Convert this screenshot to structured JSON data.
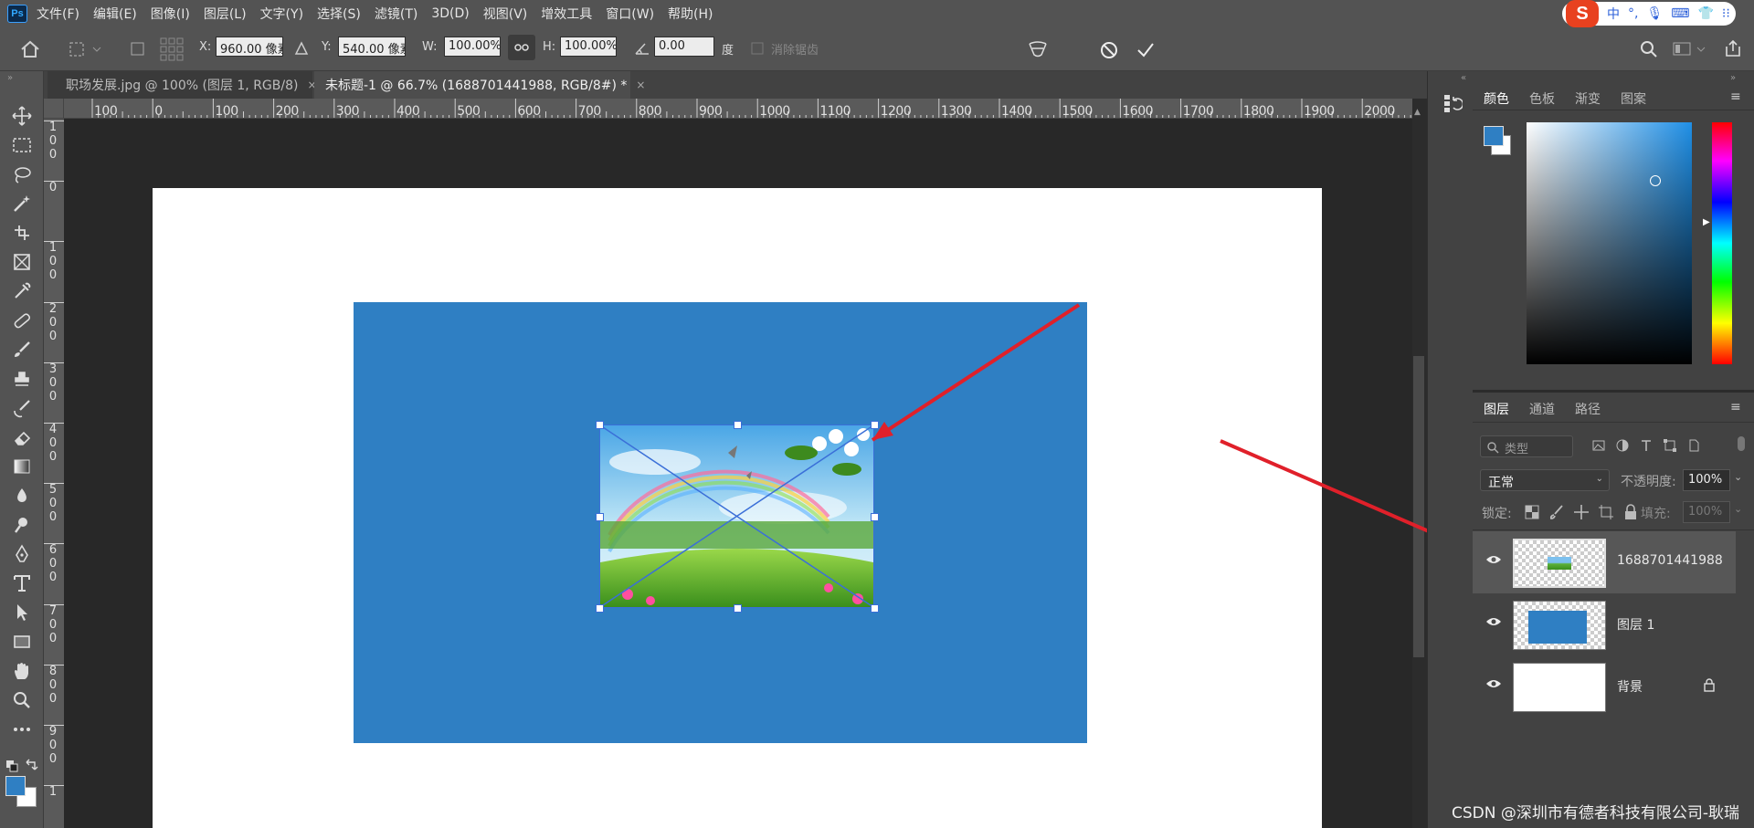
{
  "app": {
    "logo": "Ps"
  },
  "menu": [
    "文件(F)",
    "编辑(E)",
    "图像(I)",
    "图层(L)",
    "文字(Y)",
    "选择(S)",
    "滤镜(T)",
    "3D(D)",
    "视图(V)",
    "增效工具",
    "窗口(W)",
    "帮助(H)"
  ],
  "ime": {
    "logo": "S",
    "items": [
      "中",
      "°,",
      "🎙",
      "⌨",
      "👕",
      "⁝⁝"
    ]
  },
  "options": {
    "x_label": "X:",
    "x_value": "960.00 像素",
    "y_label": "Y:",
    "y_value": "540.00 像素",
    "w_label": "W:",
    "w_value": "100.00%",
    "h_label": "H:",
    "h_value": "100.00%",
    "angle_value": "0.00",
    "angle_unit": "度",
    "antialias_label": "消除锯齿"
  },
  "tabs": [
    {
      "label": "职场发展.jpg @ 100% (图层 1, RGB/8)",
      "close": "×"
    },
    {
      "label": "未标题-1 @ 66.7% (1688701441988, RGB/8#) *",
      "close": "×"
    }
  ],
  "ruler": {
    "h": [
      "100",
      "0",
      "100",
      "200",
      "300",
      "400",
      "500",
      "600",
      "700",
      "800",
      "900",
      "1000",
      "1100",
      "1200",
      "1300",
      "1400",
      "1500",
      "1600",
      "1700",
      "1800",
      "1900",
      "2000"
    ],
    "v": [
      "100",
      "0",
      "100",
      "200",
      "300",
      "400",
      "500",
      "600",
      "700",
      "800",
      "900",
      "1"
    ]
  },
  "color_panel": {
    "tabs": [
      "颜色",
      "色板",
      "渐变",
      "图案"
    ],
    "foreground": "#2f7fc3",
    "background": "#ffffff"
  },
  "layers_panel": {
    "tabs": [
      "图层",
      "通道",
      "路径"
    ],
    "search_placeholder": "类型",
    "blend_mode": "正常",
    "opacity_label": "不透明度:",
    "opacity_value": "100%",
    "lock_label": "锁定:",
    "fill_label": "填充:",
    "fill_value": "100%",
    "layers": [
      {
        "name": "1688701441988",
        "selected": true
      },
      {
        "name": "图层 1",
        "selected": false
      },
      {
        "name": "背景",
        "selected": false,
        "locked": true
      }
    ]
  },
  "watermark": "CSDN @深圳市有德者科技有限公司-耿瑞",
  "colors": {
    "accent": "#2f7fc3",
    "arrow": "#e0202a"
  }
}
